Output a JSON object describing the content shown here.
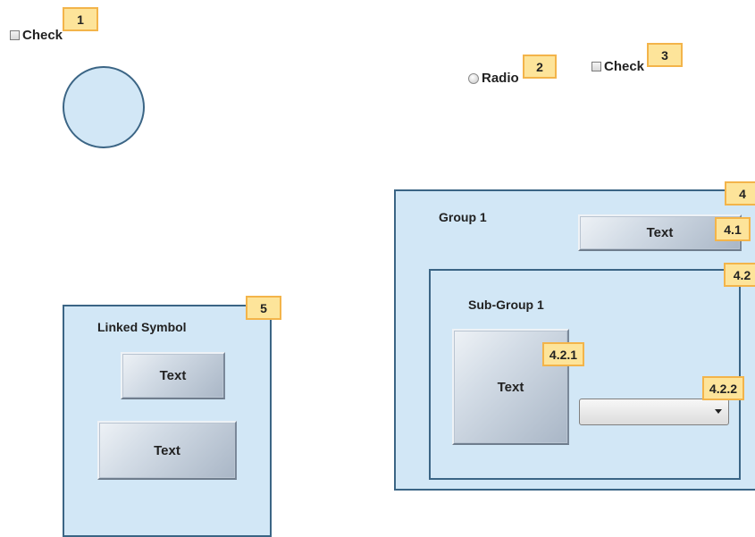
{
  "check_1": {
    "label": "Check",
    "checked": false
  },
  "radio_2": {
    "label": "Radio",
    "selected": false
  },
  "check_3": {
    "label": "Check",
    "checked": false
  },
  "badges": {
    "b1": "1",
    "b2": "2",
    "b3": "3",
    "b4": "4",
    "b41": "4.1",
    "b42": "4.2",
    "b421": "4.2.1",
    "b422": "4.2.2",
    "b5": "5"
  },
  "group_1": {
    "title": "Group 1",
    "button_label": "Text",
    "sub_group": {
      "title": "Sub-Group 1",
      "button_label": "Text",
      "dropdown_value": ""
    }
  },
  "linked_symbol": {
    "title": "Linked Symbol",
    "button_1_label": "Text",
    "button_2_label": "Text"
  },
  "colors": {
    "panel_fill": "#d2e7f6",
    "panel_border": "#3b6585",
    "badge_fill": "#fde49a",
    "badge_border": "#f3b44a"
  }
}
